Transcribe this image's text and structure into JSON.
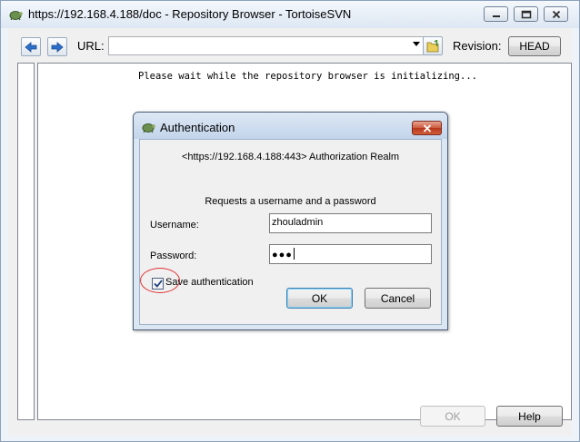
{
  "window": {
    "title": "https://192.168.4.188/doc - Repository Browser - TortoiseSVN",
    "app_icon": "tortoise-icon",
    "controls": [
      "minimize-icon",
      "maximize-icon",
      "close-icon"
    ]
  },
  "toolbar": {
    "back_icon": "arrow-left-icon",
    "forward_icon": "arrow-right-icon",
    "url_label": "URL:",
    "url_value": "",
    "folder_icon": "folder-up-icon",
    "revision_label": "Revision:",
    "revision_button": "HEAD"
  },
  "main": {
    "init_message": "Please wait while the repository browser is initializing..."
  },
  "footer": {
    "ok_label": "OK",
    "help_label": "Help"
  },
  "auth_dialog": {
    "title": "Authentication",
    "realm": "<https://192.168.4.188:443> Authorization Realm",
    "request": "Requests a username and a password",
    "username_label": "Username:",
    "username_value": "zhouladmin",
    "password_label": "Password:",
    "password_mask": "●●●",
    "save_auth_label": "Save authentication",
    "save_auth_checked": true,
    "ok_label": "OK",
    "cancel_label": "Cancel"
  },
  "colors": {
    "arrow_blue": "#2a6fc9",
    "dialog_close_red": "#c44a2c",
    "highlight_circle": "#e03030"
  }
}
